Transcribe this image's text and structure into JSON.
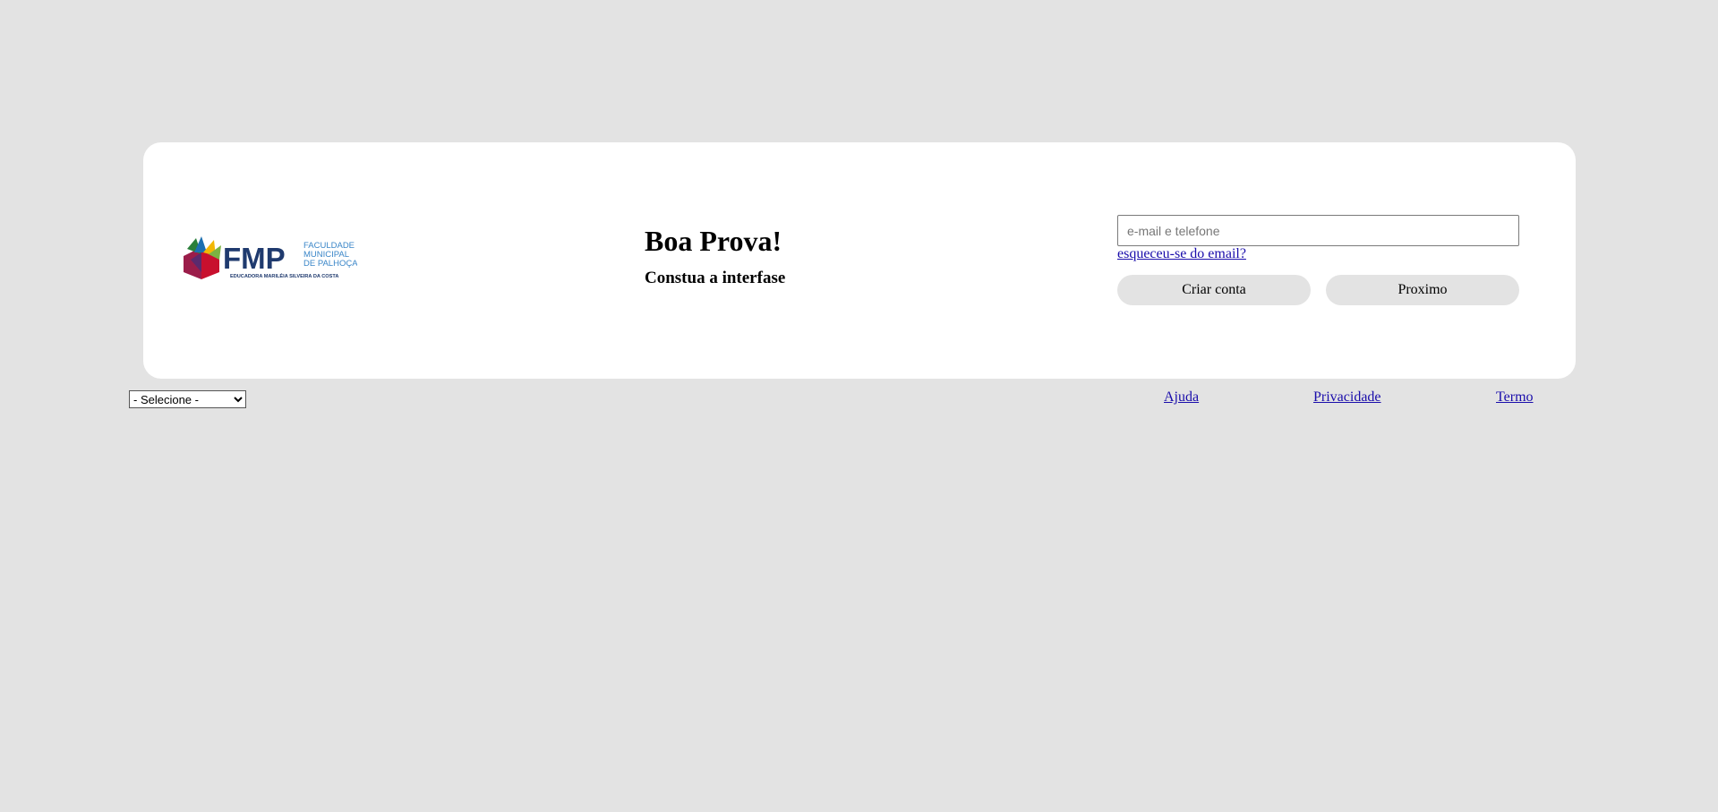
{
  "card": {
    "logo": {
      "acronym": "FMP",
      "name_line1": "FACULDADE",
      "name_line2": "MUNICIPAL",
      "name_line3": "DE PALHOÇA",
      "tagline": "EDUCADORA MARILÉIA SILVEIRA DA COSTA"
    },
    "title": "Boa Prova!",
    "subtitle": "Constua a interfase",
    "login": {
      "email_placeholder": "e-mail e telefone",
      "email_value": "",
      "forgot_link": "esqueceu-se do email?",
      "create_account_button": "Criar conta",
      "next_button": "Proximo"
    }
  },
  "footer": {
    "language_select": {
      "selected": "- Selecione -"
    },
    "links": {
      "help": "Ajuda",
      "privacy": "Privacidade",
      "terms": "Termo"
    }
  },
  "colors": {
    "background": "#e3e3e3",
    "card": "#ffffff",
    "link": "#1a0dab",
    "logo_navy": "#1f3a6e",
    "logo_blue": "#3a86c8"
  }
}
